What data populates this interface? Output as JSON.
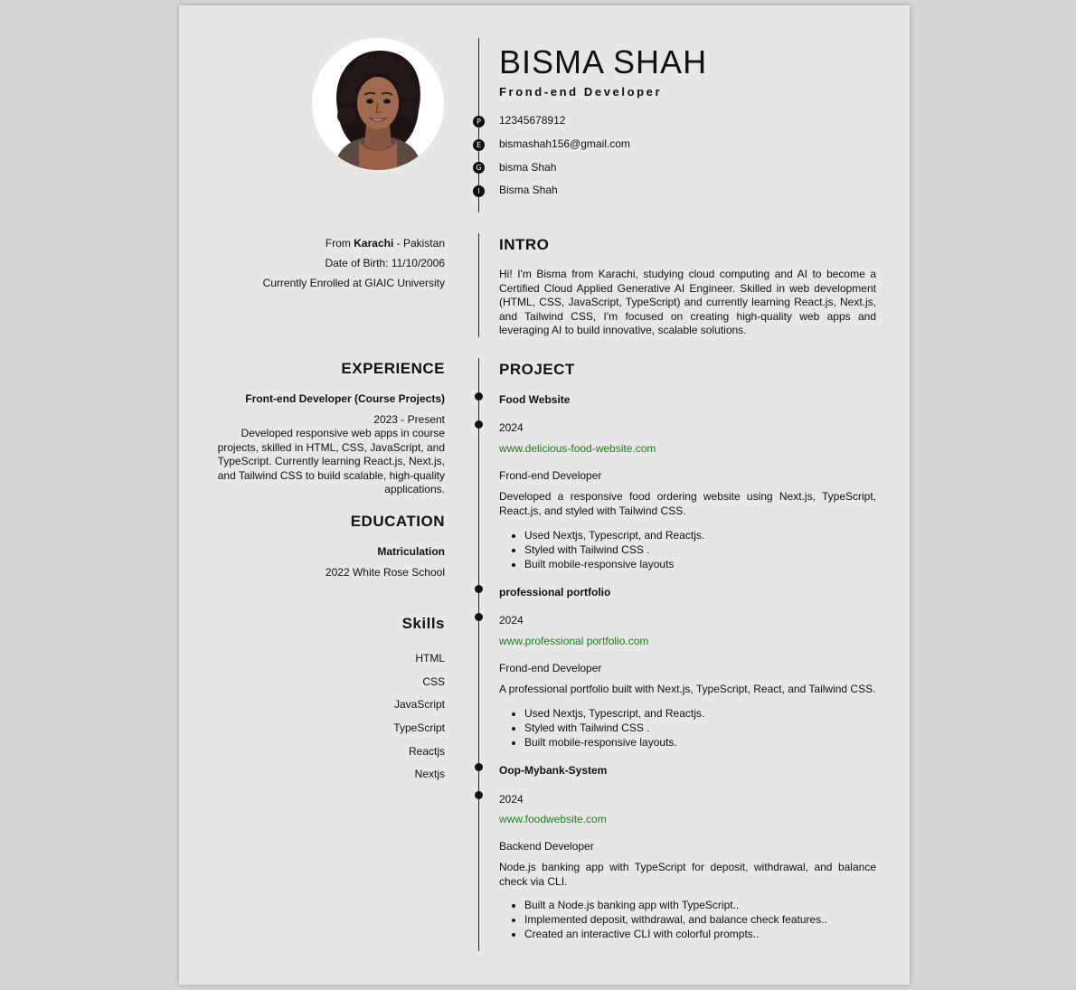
{
  "header": {
    "name": "BISMA SHAH",
    "title": "Frond-end Developer",
    "contacts": [
      {
        "marker": "P",
        "value": "12345678912"
      },
      {
        "marker": "E",
        "value": "bismashah156@gmail.com"
      },
      {
        "marker": "G",
        "value": "bisma Shah"
      },
      {
        "marker": "I",
        "value": "Bisma Shah"
      }
    ]
  },
  "info": {
    "from_prefix": "From ",
    "city": "Karachi",
    "country_suffix": " - Pakistan",
    "dob": "Date of Birth: 11/10/2006",
    "enrolled": "Currently Enrolled at GIAIC University"
  },
  "intro": {
    "heading": "INTRO",
    "text": "Hi! I'm Bisma from Karachi, studying cloud computing and AI to become a Certified Cloud Applied Generative AI Engineer. Skilled in web development (HTML, CSS, JavaScript, TypeScript) and currently learning React.js, Next.js, and Tailwind CSS, I'm focused on creating high-quality web apps and leveraging AI to build innovative, scalable solutions."
  },
  "experience": {
    "heading": "EXPERIENCE",
    "role": "Front-end Developer (Course Projects)",
    "period": "2023 - Present",
    "description": "Developed responsive web apps in course projects, skilled in HTML, CSS, JavaScript, and TypeScript. Currently learning React.js, Next.js, and Tailwind CSS to build scalable, high-quality applications."
  },
  "education": {
    "heading": "EDUCATION",
    "degree": "Matriculation",
    "detail": "2022 White Rose School"
  },
  "skills": {
    "heading": "Skills",
    "items": [
      "HTML",
      "CSS",
      "JavaScript",
      "TypeScript",
      "Reactjs",
      "Nextjs"
    ]
  },
  "projects": {
    "heading": "PROJECT",
    "items": [
      {
        "title": "Food Website",
        "year": "2024",
        "link": "www.delicious-food-website.com",
        "role": "Frond-end Developer",
        "description": "Developed a responsive food ordering website using Next.js, TypeScript, React.js, and styled with Tailwind CSS.",
        "bullets": [
          "Used Nextjs, Typescript, and Reactjs.",
          "Styled with Tailwind CSS .",
          "Built mobile-responsive layouts"
        ]
      },
      {
        "title": "professional portfolio",
        "year": "2024",
        "link": "www.professional portfolio.com",
        "role": "Frond-end Developer",
        "description": "A professional portfolio built with Next.js, TypeScript, React, and Tailwind CSS.",
        "bullets": [
          "Used Nextjs, Typescript, and Reactjs.",
          "Styled with Tailwind CSS .",
          "Built mobile-responsive layouts."
        ]
      },
      {
        "title": "Oop-Mybank-System",
        "year": "2024",
        "link": "www.foodwebsite.com",
        "role": "Backend Developer",
        "description": "Node.js banking app with TypeScript for deposit, withdrawal, and balance check via CLI.",
        "bullets": [
          "Built a Node.js banking app with TypeScript..",
          "Implemented deposit, withdrawal, and balance check features..",
          "Created an interactive CLI with colorful prompts.."
        ]
      }
    ]
  },
  "colors": {
    "page_background": "#e8e7e5",
    "link": "#1a7f1a",
    "text": "#111111"
  }
}
